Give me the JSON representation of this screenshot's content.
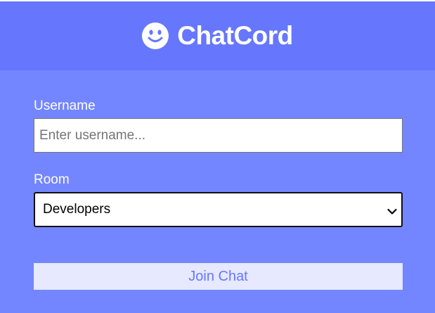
{
  "header": {
    "title": "ChatCord",
    "logo_icon": "smiley-icon"
  },
  "form": {
    "username": {
      "label": "Username",
      "placeholder": "Enter username...",
      "value": ""
    },
    "room": {
      "label": "Room",
      "selected": "Developers"
    },
    "submit_label": "Join Chat"
  },
  "colors": {
    "header_bg": "#6677fe",
    "body_bg": "#7386ff",
    "button_bg": "#e6e9ff",
    "button_text": "#6677fe",
    "text_on_accent": "#ffffff"
  }
}
